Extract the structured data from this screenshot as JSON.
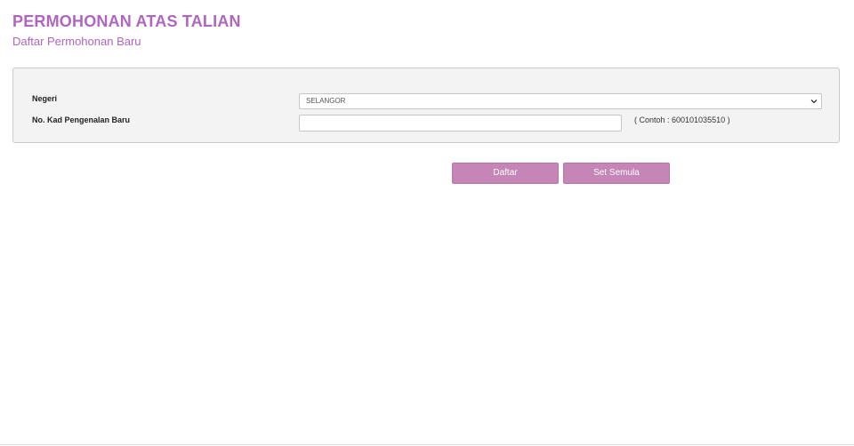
{
  "header": {
    "title": "PERMOHONAN ATAS TALIAN",
    "subtitle": "Daftar Permohonan Baru"
  },
  "form": {
    "negeri_label": "Negeri",
    "negeri_value": "SELANGOR",
    "kad_label": "No. Kad Pengenalan Baru",
    "kad_value": "",
    "kad_hint": "( Contoh : 600101035510 )"
  },
  "actions": {
    "daftar_label": "Daftar",
    "reset_label": "Set Semula"
  },
  "colors": {
    "accent": "#b065c0",
    "button": "#c585b7",
    "panel_bg": "#f3f3f3"
  },
  "icons": {
    "select_arrow": "chevron-down-icon"
  }
}
